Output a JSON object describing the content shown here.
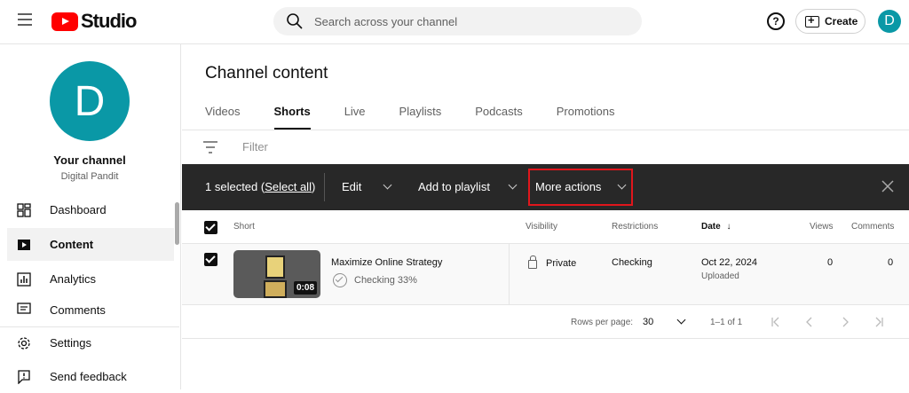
{
  "app": {
    "logo_text": "Studio"
  },
  "search": {
    "placeholder": "Search across your channel"
  },
  "header": {
    "help_label": "?",
    "create_label": "Create",
    "avatar_letter": "D"
  },
  "channel": {
    "avatar_letter": "D",
    "title": "Your channel",
    "name": "Digital Pandit"
  },
  "sidebar": {
    "items": [
      {
        "label": "Dashboard",
        "icon": "dashboard-icon"
      },
      {
        "label": "Content",
        "icon": "content-icon",
        "active": true
      },
      {
        "label": "Analytics",
        "icon": "analytics-icon"
      },
      {
        "label": "Comments",
        "icon": "comments-icon"
      },
      {
        "label": "Settings",
        "icon": "gear-icon"
      },
      {
        "label": "Send feedback",
        "icon": "feedback-icon"
      }
    ]
  },
  "page": {
    "title": "Channel content"
  },
  "tabs": [
    {
      "label": "Videos"
    },
    {
      "label": "Shorts",
      "active": true
    },
    {
      "label": "Live"
    },
    {
      "label": "Playlists"
    },
    {
      "label": "Podcasts"
    },
    {
      "label": "Promotions"
    }
  ],
  "filter": {
    "placeholder": "Filter"
  },
  "action_bar": {
    "selected_prefix": "1 selected (",
    "select_all": "Select all",
    "selected_suffix": ")",
    "edit": "Edit",
    "add_to_playlist": "Add to playlist",
    "more_actions": "More actions",
    "highlight_color": "#e0161c"
  },
  "table": {
    "headers": {
      "short": "Short",
      "visibility": "Visibility",
      "restrictions": "Restrictions",
      "date": "Date",
      "views": "Views",
      "comments": "Comments"
    },
    "rows": [
      {
        "title": "Maximize Online Strategy",
        "duration": "0:08",
        "status": "Checking 33%",
        "visibility": "Private",
        "restrictions": "Checking",
        "date": "Oct 22, 2024",
        "date_sub": "Uploaded",
        "views": "0",
        "comments": "0",
        "checked": true
      }
    ]
  },
  "pager": {
    "rows_label": "Rows per page:",
    "rows_value": "30",
    "range": "1–1 of 1"
  },
  "colors": {
    "brand_red": "#ff0000",
    "avatar_teal": "#0a98a6",
    "action_bar_bg": "#282828"
  }
}
